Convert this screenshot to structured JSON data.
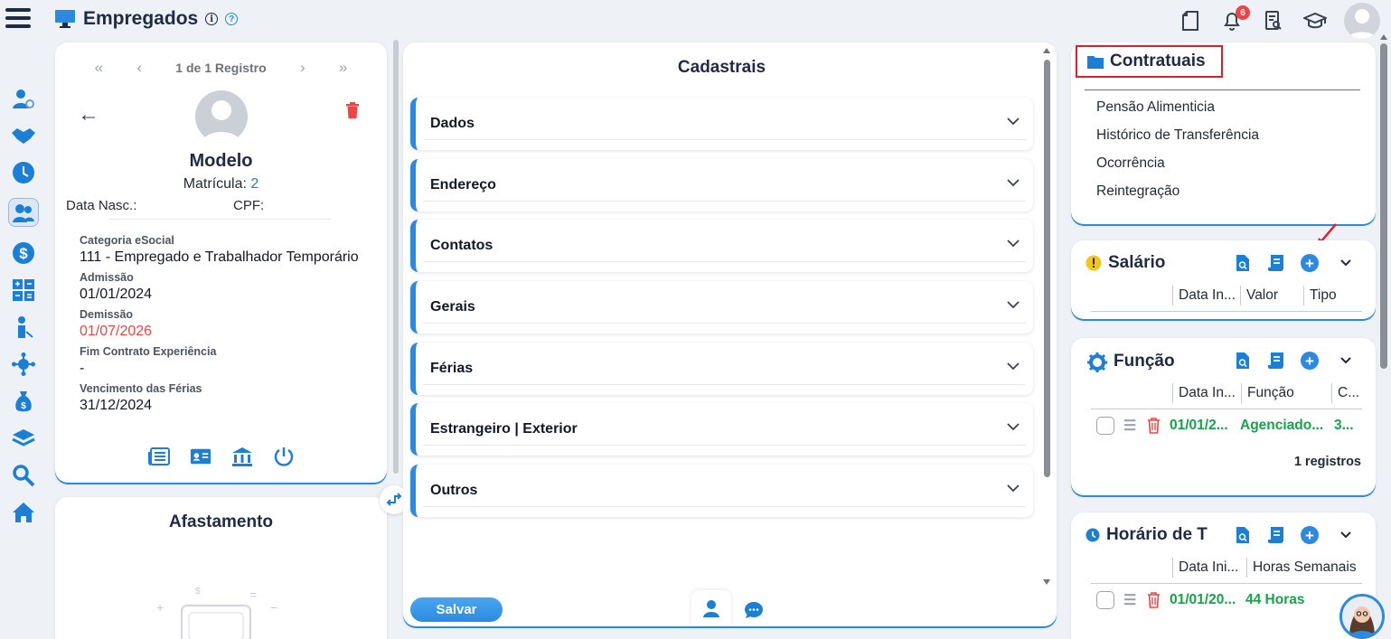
{
  "header": {
    "title": "Empregados",
    "notifications_count": "6"
  },
  "profile": {
    "pager_label": "1 de 1 Registro",
    "name": "Modelo",
    "matricula_label": "Matrícula:",
    "matricula_value": "2",
    "data_nasc_label": "Data Nasc.:",
    "cpf_label": "CPF:",
    "fields": [
      {
        "label": "Categoria eSocial",
        "value": "111 - Empregado e Trabalhador Temporário"
      },
      {
        "label": "Admissão",
        "value": "01/01/2024"
      },
      {
        "label": "Demissão",
        "value": "01/07/2026"
      },
      {
        "label": "Fim Contrato Experiência",
        "value": "-"
      },
      {
        "label": "Vencimento das Férias",
        "value": "31/12/2024"
      }
    ]
  },
  "afastamento": {
    "title": "Afastamento"
  },
  "cadastrais": {
    "title": "Cadastrais",
    "sections": [
      "Dados",
      "Endereço",
      "Contatos",
      "Gerais",
      "Férias",
      "Estrangeiro | Exterior",
      "Outros"
    ],
    "save_label": "Salvar"
  },
  "contratuais": {
    "title": "Contratuais",
    "items": [
      "Pensão Alimenticia",
      "Histórico de Transferência",
      "Ocorrência",
      "Reintegração"
    ]
  },
  "salario": {
    "title": "Salário",
    "columns": [
      "Data In...",
      "Valor",
      "Tipo"
    ]
  },
  "funcao": {
    "title": "Função",
    "columns": [
      "Data In...",
      "Função",
      "C..."
    ],
    "rows": [
      {
        "date": "01/01/2...",
        "funcao": "Agenciado...",
        "c": "3..."
      }
    ],
    "count": "1 registros"
  },
  "horario": {
    "title": "Horário de T",
    "columns": [
      "Data Ini...",
      "Horas Semanais"
    ],
    "rows": [
      {
        "date": "01/01/20...",
        "horas": "44 Horas"
      }
    ]
  },
  "colors": {
    "accent": "#2b8ae0",
    "danger": "#ef4444",
    "success": "#16a34a",
    "highlight_border": "#e11d2a"
  }
}
